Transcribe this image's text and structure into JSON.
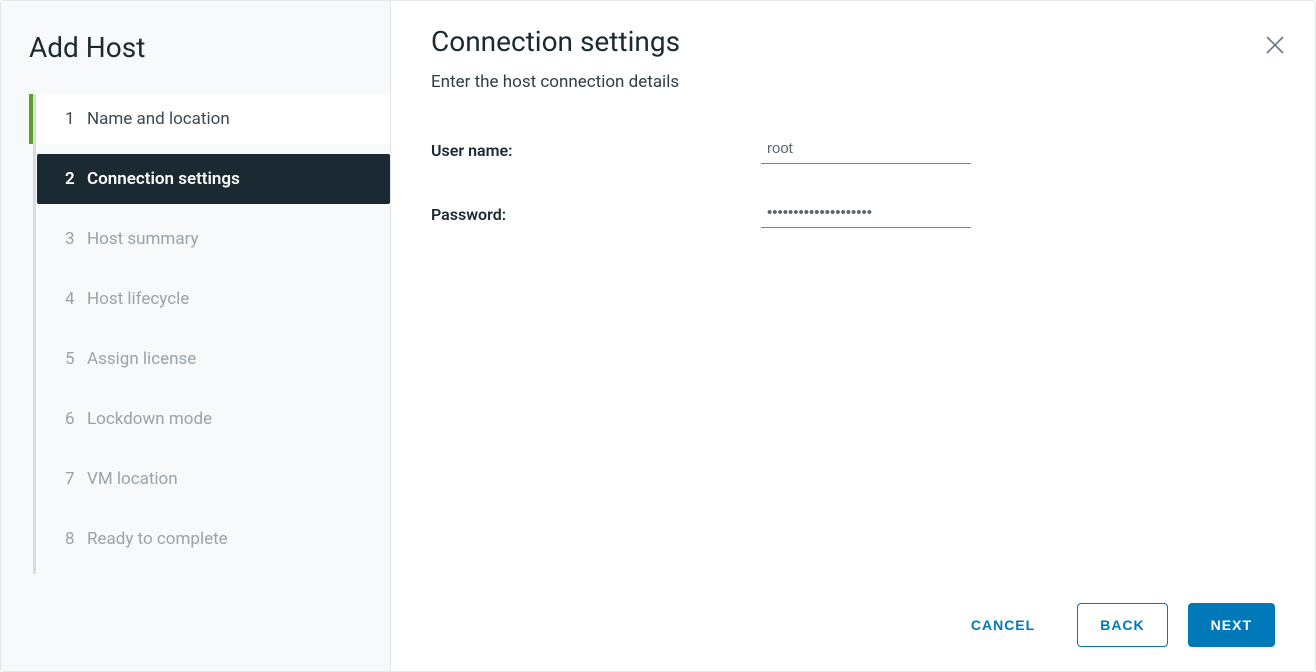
{
  "wizard": {
    "title": "Add Host",
    "steps": [
      {
        "num": "1",
        "label": "Name and location",
        "state": "completed"
      },
      {
        "num": "2",
        "label": "Connection settings",
        "state": "active"
      },
      {
        "num": "3",
        "label": "Host summary",
        "state": "pending"
      },
      {
        "num": "4",
        "label": "Host lifecycle",
        "state": "pending"
      },
      {
        "num": "5",
        "label": "Assign license",
        "state": "pending"
      },
      {
        "num": "6",
        "label": "Lockdown mode",
        "state": "pending"
      },
      {
        "num": "7",
        "label": "VM location",
        "state": "pending"
      },
      {
        "num": "8",
        "label": "Ready to complete",
        "state": "pending"
      }
    ]
  },
  "page": {
    "title": "Connection settings",
    "subtitle": "Enter the host connection details",
    "fields": {
      "username_label": "User name:",
      "username_value": "root",
      "password_label": "Password:",
      "password_value": "••••••••••••••••••••"
    }
  },
  "footer": {
    "cancel": "CANCEL",
    "back": "BACK",
    "next": "NEXT"
  }
}
